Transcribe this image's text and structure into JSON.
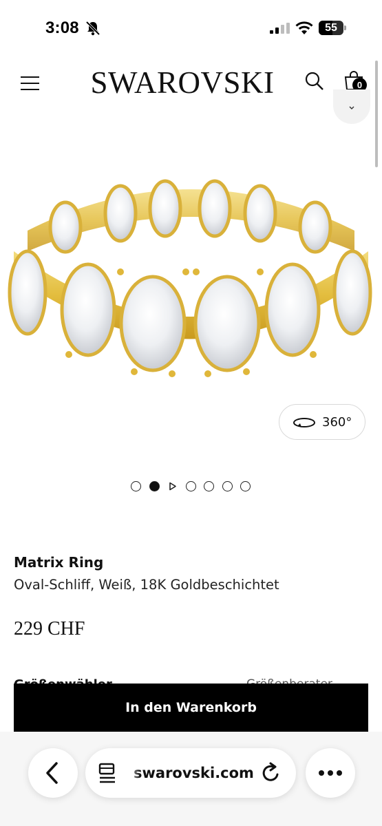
{
  "status_bar": {
    "time": "3:08",
    "battery": "55",
    "battery_level": 0.55
  },
  "header": {
    "logo": "SWAROVSKI",
    "cart_count": "0"
  },
  "gallery": {
    "view360_label": "360°",
    "image_count": 7,
    "active_index": 1,
    "video_index": 2
  },
  "product": {
    "name": "Matrix Ring",
    "description": "Oval-Schliff, Weiß, 18K Goldbeschichtet",
    "price": "229 CHF",
    "size_label": "Größenwähler",
    "size_guide": "Größenberater"
  },
  "cta": {
    "add_to_cart": "In den Warenkorb"
  },
  "browser": {
    "url": "swarovski.com"
  },
  "icons": {
    "status": [
      "notifications-off-icon",
      "cellular-signal-icon",
      "wifi-icon",
      "battery-icon"
    ],
    "header": [
      "hamburger-menu-icon",
      "search-icon",
      "shopping-bag-icon",
      "chevron-down-icon"
    ],
    "browser": [
      "back-chevron-icon",
      "tabs-icon",
      "reload-icon",
      "more-dots-icon"
    ]
  },
  "colors": {
    "gold": "#e8c54a",
    "button_bg": "#000000",
    "browser_bg": "#f6f6f6"
  }
}
